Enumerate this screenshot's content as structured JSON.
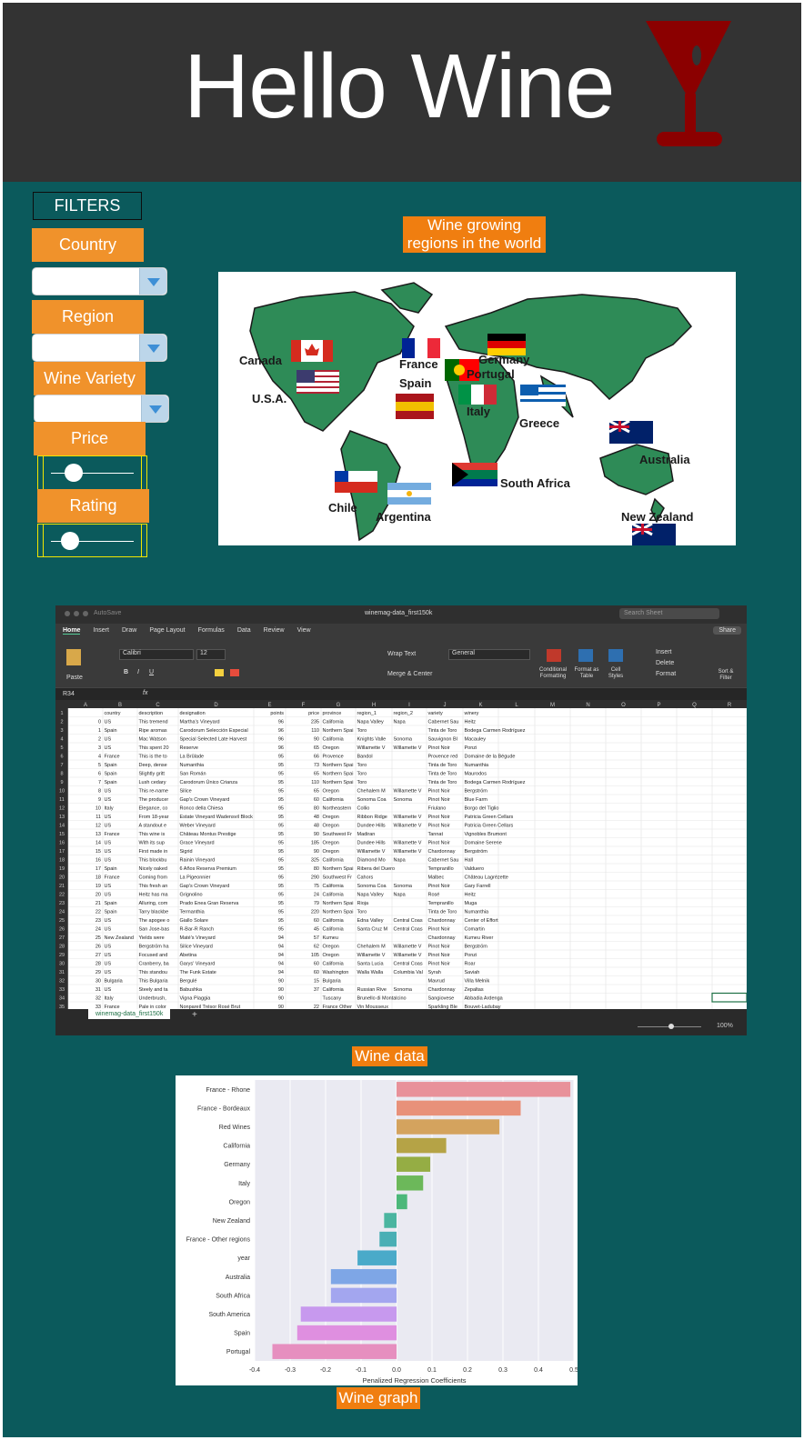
{
  "header": {
    "title": "Hello Wine"
  },
  "filters": {
    "title": "FILTERS",
    "country_label": "Country",
    "region_label": "Region",
    "variety_label": "Wine Variety",
    "price_label": "Price",
    "rating_label": "Rating"
  },
  "map_section": {
    "title_line1": "Wine growing",
    "title_line2": "regions in the world",
    "labels": [
      "Canada",
      "U.S.A.",
      "France",
      "Spain",
      "Germany",
      "Portugal",
      "Italy",
      "Greece",
      "Australia",
      "South Africa",
      "Chile",
      "Argentina",
      "New Zealand"
    ]
  },
  "spreadsheet": {
    "filename": "winemag-data_first150k",
    "search_placeholder": "Search Sheet",
    "share_label": "Share",
    "autosave": "AutoSave",
    "tabs": [
      "Home",
      "Insert",
      "Draw",
      "Page Layout",
      "Formulas",
      "Data",
      "Review",
      "View"
    ],
    "font_name": "Calibri",
    "font_size": "12",
    "number_format": "General",
    "cell_ref": "R34",
    "wrap_text": "Wrap Text",
    "merge_center": "Merge & Center",
    "ribbon_buttons": [
      "Conditional Formatting",
      "Format as Table",
      "Cell Styles",
      "Insert",
      "Delete",
      "Format",
      "Sort & Filter"
    ],
    "paste_label": "Paste",
    "columns": [
      "A",
      "B",
      "C",
      "D",
      "E",
      "F",
      "G",
      "H",
      "I",
      "J",
      "K",
      "L",
      "M",
      "N",
      "O",
      "P",
      "Q",
      "R"
    ],
    "header_row": [
      "",
      "country",
      "description",
      "designation",
      "points",
      "price",
      "province",
      "region_1",
      "region_2",
      "variety",
      "winery"
    ],
    "rows": [
      [
        "0",
        "US",
        "This tremend",
        "Martha's Vineyard",
        "96",
        "235",
        "California",
        "Napa Valley",
        "Napa",
        "Cabernet Sau",
        "Heitz"
      ],
      [
        "1",
        "Spain",
        "Ripe aromas",
        "Carodorum Selección Especial",
        "96",
        "110",
        "Northern Spai",
        "Toro",
        "",
        "Tinta de Toro",
        "Bodega Carmen Rodríguez"
      ],
      [
        "2",
        "US",
        "Mac Watson",
        "Special Selected Late Harvest",
        "96",
        "90",
        "California",
        "Knights Valle",
        "Sonoma",
        "Sauvignon Bl",
        "Macauley"
      ],
      [
        "3",
        "US",
        "This spent 20",
        "Reserve",
        "96",
        "65",
        "Oregon",
        "Willamette V",
        "Willamette V",
        "Pinot Noir",
        "Ponzi"
      ],
      [
        "4",
        "France",
        "This is the to",
        "La Brûlade",
        "95",
        "66",
        "Provence",
        "Bandol",
        "",
        "Provence red",
        "Domaine de la Bégude"
      ],
      [
        "5",
        "Spain",
        "Deep, dense",
        "Numanthia",
        "95",
        "73",
        "Northern Spai",
        "Toro",
        "",
        "Tinta de Toro",
        "Numanthia"
      ],
      [
        "6",
        "Spain",
        "Slightly gritt",
        "San Román",
        "95",
        "65",
        "Northern Spai",
        "Toro",
        "",
        "Tinta de Toro",
        "Maurodos"
      ],
      [
        "7",
        "Spain",
        "Lush cedary",
        "Carodorum Único Crianza",
        "95",
        "110",
        "Northern Spai",
        "Toro",
        "",
        "Tinta de Toro",
        "Bodega Carmen Rodríguez"
      ],
      [
        "8",
        "US",
        "This re-name",
        "Silice",
        "95",
        "65",
        "Oregon",
        "Chehalem M",
        "Willamette V",
        "Pinot Noir",
        "Bergström"
      ],
      [
        "9",
        "US",
        "The producer",
        "Gap's Crown Vineyard",
        "95",
        "60",
        "California",
        "Sonoma Coa",
        "Sonoma",
        "Pinot Noir",
        "Blue Farm"
      ],
      [
        "10",
        "Italy",
        "Elegance, co",
        "Ronco della Chiesa",
        "95",
        "80",
        "Northeastern",
        "Collio",
        "",
        "Friulano",
        "Borgo del Tiglio"
      ],
      [
        "11",
        "US",
        "From 18-year",
        "Estate Vineyard Wadensvil Block",
        "95",
        "48",
        "Oregon",
        "Ribbon Ridge",
        "Willamette V",
        "Pinot Noir",
        "Patricia Green Cellars"
      ],
      [
        "12",
        "US",
        "A standout e",
        "Weber Vineyard",
        "95",
        "48",
        "Oregon",
        "Dundee Hills",
        "Willamette V",
        "Pinot Noir",
        "Patricia Green Cellars"
      ],
      [
        "13",
        "France",
        "This wine is",
        "Château Montus Prestige",
        "95",
        "90",
        "Southwest Fr",
        "Madiran",
        "",
        "Tannat",
        "Vignobles Brumont"
      ],
      [
        "14",
        "US",
        "With its sup",
        "Grace Vineyard",
        "95",
        "185",
        "Oregon",
        "Dundee Hills",
        "Willamette V",
        "Pinot Noir",
        "Domaine Serene"
      ],
      [
        "15",
        "US",
        "First made in",
        "Sigrid",
        "95",
        "90",
        "Oregon",
        "Willamette V",
        "Willamette V",
        "Chardonnay",
        "Bergström"
      ],
      [
        "16",
        "US",
        "This blockbu",
        "Rainin Vineyard",
        "95",
        "325",
        "California",
        "Diamond Mo",
        "Napa",
        "Cabernet Sau",
        "Hall"
      ],
      [
        "17",
        "Spain",
        "Nicely oaked",
        "6 Años Reserva Premium",
        "95",
        "80",
        "Northern Spai",
        "Ribera del Duero",
        "",
        "Tempranillo",
        "Valduero"
      ],
      [
        "18",
        "France",
        "Coming from",
        "La Pigeonnier",
        "95",
        "290",
        "Southwest Fr",
        "Cahors",
        "",
        "Malbec",
        "Château Lagrézette"
      ],
      [
        "19",
        "US",
        "This fresh an",
        "Gap's Crown Vineyard",
        "95",
        "75",
        "California",
        "Sonoma Coa",
        "Sonoma",
        "Pinot Noir",
        "Gary Farrell"
      ],
      [
        "20",
        "US",
        "Heitz has ma",
        "Grignolino",
        "95",
        "24",
        "California",
        "Napa Valley",
        "Napa",
        "Rosé",
        "Heitz"
      ],
      [
        "21",
        "Spain",
        "Alluring, com",
        "Prado Enea Gran Reserva",
        "95",
        "79",
        "Northern Spai",
        "Rioja",
        "",
        "Tempranillo",
        "Muga"
      ],
      [
        "22",
        "Spain",
        "Tarry blackbe",
        "Termanthia",
        "95",
        "220",
        "Northern Spai",
        "Toro",
        "",
        "Tinta de Toro",
        "Numanthia"
      ],
      [
        "23",
        "US",
        "The apogee o",
        "Giallo Solare",
        "95",
        "60",
        "California",
        "Edna Valley",
        "Central Coas",
        "Chardonnay",
        "Center of Effort"
      ],
      [
        "24",
        "US",
        "San Jose-bas",
        "R-Bar-R Ranch",
        "95",
        "45",
        "California",
        "Santa Cruz M",
        "Central Coas",
        "Pinot Noir",
        "Comartin"
      ],
      [
        "25",
        "New Zealand",
        "Yields were",
        "Maté's Vineyard",
        "94",
        "57",
        "Kumeu",
        "",
        "",
        "Chardonnay",
        "Kumeu River"
      ],
      [
        "26",
        "US",
        "Bergström ha",
        "Silice Vineyard",
        "94",
        "62",
        "Oregon",
        "Chehalem M",
        "Willamette V",
        "Pinot Noir",
        "Bergström"
      ],
      [
        "27",
        "US",
        "Focused and",
        "Abetina",
        "94",
        "105",
        "Oregon",
        "Willamette V",
        "Willamette V",
        "Pinot Noir",
        "Ponzi"
      ],
      [
        "28",
        "US",
        "Cranberry, ba",
        "Garys' Vineyard",
        "94",
        "60",
        "California",
        "Santa Lucia",
        "Central Coas",
        "Pinot Noir",
        "Roar"
      ],
      [
        "29",
        "US",
        "This standou",
        "The Funk Estate",
        "94",
        "60",
        "Washington",
        "Walla Walla",
        "Columbia Val",
        "Syrah",
        "Saviah"
      ],
      [
        "30",
        "Bulgaria",
        "This Bulgaria",
        "Bergulé",
        "90",
        "15",
        "Bulgaria",
        "",
        "",
        "Mavrud",
        "Villa Melnik"
      ],
      [
        "31",
        "US",
        "Steely and ta",
        "Babushka",
        "90",
        "37",
        "California",
        "Russian Rive",
        "Sonoma",
        "Chardonnay",
        "Zepaltas"
      ],
      [
        "32",
        "Italy",
        "Underbrush,",
        "Vigna Piaggia",
        "90",
        "",
        "Tuscany",
        "Brunello di Montalcino",
        "",
        "Sangiovese",
        "Abbadia Ardenga"
      ],
      [
        "33",
        "France",
        "Pale in color",
        "Nonpareil Trésor Rosé Brut",
        "90",
        "22",
        "France Other",
        "Vin Mousseux",
        "",
        "Sparkling Ble",
        "Bouvet-Ladubay"
      ]
    ],
    "sheet_tab": "winemag-data_first150k",
    "zoom": "100%"
  },
  "wine_data_label": "Wine data",
  "chart_data": {
    "type": "bar",
    "orientation": "horizontal",
    "categories": [
      "France - Rhone",
      "France - Bordeaux",
      "Red Wines",
      "California",
      "Germany",
      "Italy",
      "Oregon",
      "New Zealand",
      "France - Other regions",
      "year",
      "Australia",
      "South Africa",
      "South America",
      "Spain",
      "Portugal"
    ],
    "values": [
      0.49,
      0.35,
      0.29,
      0.14,
      0.095,
      0.075,
      0.03,
      -0.035,
      -0.048,
      -0.11,
      -0.185,
      -0.185,
      -0.27,
      -0.28,
      -0.35
    ],
    "colors": [
      "#e8919a",
      "#e8917a",
      "#d4a35e",
      "#b5a346",
      "#95ad44",
      "#6cb85a",
      "#4cb87a",
      "#4bb5a0",
      "#4aafb5",
      "#4aaac9",
      "#7ea6e6",
      "#a3a6ef",
      "#c799ee",
      "#df8fe0",
      "#e68fbf"
    ],
    "xlabel": "Penalized Regression Coefficients",
    "ylabel": "",
    "xlim": [
      -0.4,
      0.5
    ],
    "xticks": [
      "-0.4",
      "-0.3",
      "-0.2",
      "-0.1",
      "0.0",
      "0.1",
      "0.2",
      "0.3",
      "0.4",
      "0.5"
    ],
    "grid": true
  },
  "wine_graph_label": "Wine graph"
}
